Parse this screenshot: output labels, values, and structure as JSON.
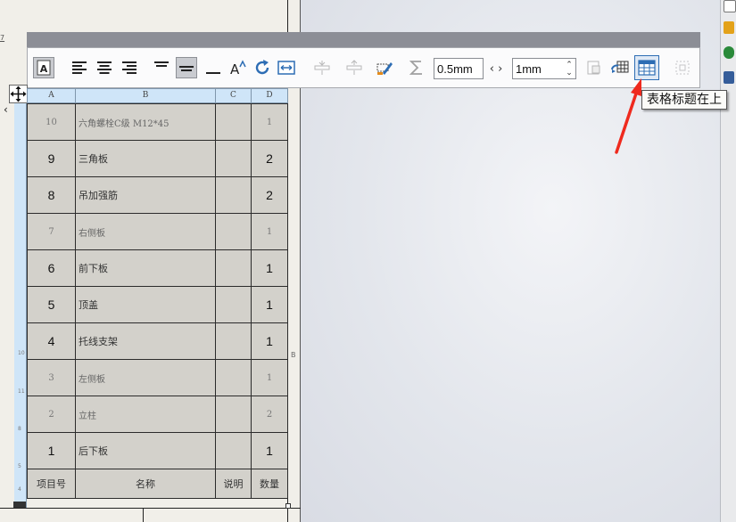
{
  "sheet": {
    "margin_mark": "7",
    "zone_letter": "B"
  },
  "toolbar": {
    "spacing_value": "0.5mm",
    "thickness_value": "1mm",
    "tooltip": "表格标题在上"
  },
  "table": {
    "columns": [
      "A",
      "B",
      "C",
      "D"
    ],
    "rows": [
      {
        "item": "10",
        "name": "六角螺栓C级 M12*45",
        "desc": "",
        "qty": "1",
        "style": "light"
      },
      {
        "item": "9",
        "name": "三角板",
        "desc": "",
        "qty": "2",
        "style": "bold"
      },
      {
        "item": "8",
        "name": "吊加强筋",
        "desc": "",
        "qty": "2",
        "style": "bold"
      },
      {
        "item": "7",
        "name": "右侧板",
        "desc": "",
        "qty": "1",
        "style": "light"
      },
      {
        "item": "6",
        "name": "前下板",
        "desc": "",
        "qty": "1",
        "style": "bold"
      },
      {
        "item": "5",
        "name": "顶盖",
        "desc": "",
        "qty": "1",
        "style": "bold"
      },
      {
        "item": "4",
        "name": "托线支架",
        "desc": "",
        "qty": "1",
        "style": "bold"
      },
      {
        "item": "3",
        "name": "左侧板",
        "desc": "",
        "qty": "1",
        "style": "light"
      },
      {
        "item": "2",
        "name": "立柱",
        "desc": "",
        "qty": "2",
        "style": "light"
      },
      {
        "item": "1",
        "name": "后下板",
        "desc": "",
        "qty": "1",
        "style": "bold"
      }
    ],
    "header": {
      "item": "项目号",
      "name": "名称",
      "desc": "说明",
      "qty": "数量"
    },
    "row_marks": [
      "10",
      "11",
      "8",
      "5",
      "4"
    ]
  }
}
